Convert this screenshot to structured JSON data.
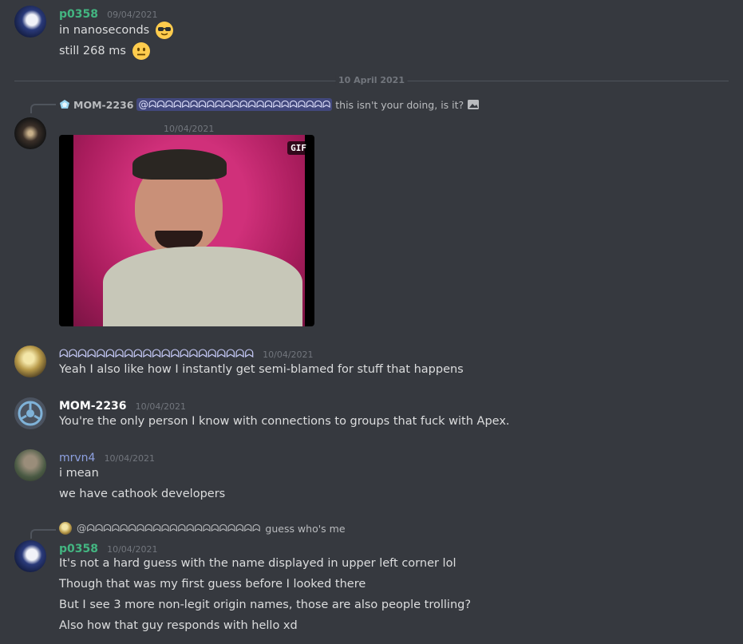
{
  "messages": {
    "m1": {
      "author": "p0358",
      "author_color": "#43b581",
      "timestamp": "09/04/2021",
      "lines": [
        "in nanoseconds",
        "still 268 ms"
      ]
    },
    "date_divider": "10 April 2021",
    "m2": {
      "reply_author": "MOM-2236",
      "reply_mention": "@ᗣᗣᗣᗣᗣᗣᗣᗣᗣᗣᗣᗣᗣᗣᗣᗣᗣᗣᗣᗣᗣᗣ",
      "reply_text": "this isn't your doing, is it?",
      "timestamp": "10/04/2021",
      "gif_badge": "GIF"
    },
    "m3": {
      "author": "ᗣᗣᗣᗣᗣᗣᗣᗣᗣᗣᗣᗣᗣᗣᗣᗣᗣᗣᗣᗣᗣ",
      "author_color": "#c9cdfb",
      "timestamp": "10/04/2021",
      "lines": [
        "Yeah I also like how I instantly get semi-blamed for stuff that happens"
      ]
    },
    "m4": {
      "author": "MOM-2236",
      "author_color": "#ffffff",
      "timestamp": "10/04/2021",
      "lines": [
        "You're the only person I know with connections to groups that fuck with Apex."
      ]
    },
    "m5": {
      "author": "mrvn4",
      "author_color": "#8ea1e1",
      "timestamp": "10/04/2021",
      "lines": [
        "i mean",
        "we have cathook developers"
      ]
    },
    "m6": {
      "reply_mention": "@ᗣᗣᗣᗣᗣᗣᗣᗣᗣᗣᗣᗣᗣᗣᗣᗣᗣᗣᗣᗣᗣ",
      "reply_text": "guess who's me",
      "author": "p0358",
      "author_color": "#43b581",
      "timestamp": "10/04/2021",
      "lines": [
        "It's not a hard guess with the name displayed in upper left corner lol",
        "Though that was my first guess before I looked there",
        "But I see 3 more non-legit origin names, those are also people trolling?",
        "Also how that guy responds with hello xd"
      ]
    }
  },
  "icons": {
    "sunglasses": "sunglasses-emoji-icon",
    "neutral": "neutral-face-emoji-icon",
    "image": "image-icon"
  }
}
